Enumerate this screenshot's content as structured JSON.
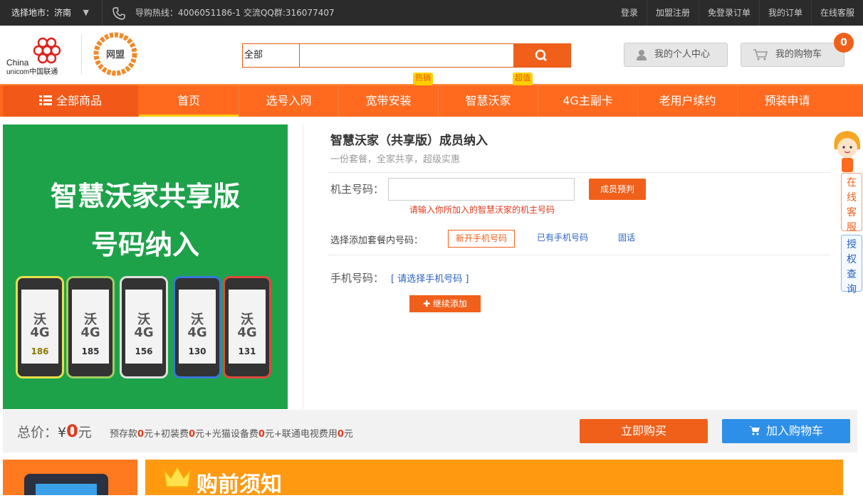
{
  "topbar": {
    "city_label": "选择地市：济南",
    "city_arrow": "▼",
    "hotline": "导购热线：4006051186-1   交流QQ群:316077407",
    "links": [
      "登录",
      "加盟注册",
      "免登录订单",
      "我的订单",
      "在线客服"
    ]
  },
  "header": {
    "logo_china": "China",
    "logo_unicom": "unicom中国联通",
    "logo_wm": "网盟",
    "search_category": "全部",
    "search_placeholder": "",
    "my_center": "我的个人中心",
    "my_cart": "我的购物车",
    "cart_count": "0"
  },
  "nav": {
    "all_goods": "全部商品",
    "items": [
      "首页",
      "选号入网",
      "宽带安装",
      "智慧沃家",
      "4G主副卡",
      "老用户续约",
      "预装申请"
    ],
    "tags": {
      "hot": "热销",
      "value": "超值"
    }
  },
  "banner": {
    "line1": "智慧沃家共享版",
    "line2": "号码纳入",
    "phones": [
      {
        "wo": "沃",
        "g": "4G",
        "num": "186",
        "frame": "#e8e04a",
        "numcolor": "#8a7a00"
      },
      {
        "wo": "沃",
        "g": "4G",
        "num": "185",
        "frame": "#a0d060",
        "numcolor": "#333"
      },
      {
        "wo": "沃",
        "g": "4G",
        "num": "156",
        "frame": "#e0e0e0",
        "numcolor": "#333"
      },
      {
        "wo": "沃",
        "g": "4G",
        "num": "130",
        "frame": "#3a78d8",
        "numcolor": "#333"
      },
      {
        "wo": "沃",
        "g": "4G",
        "num": "131",
        "frame": "#e04a3a",
        "numcolor": "#333"
      }
    ]
  },
  "product": {
    "title": "智慧沃家（共享版）成员纳入",
    "subtitle": "一份套餐，全家共享，超级实惠",
    "owner_label": "机主号码：",
    "owner_hint": "请输入你所加入的智慧沃家的机主号码",
    "check_button": "成员预判",
    "choose_label": "选择添加套餐内号码：",
    "options": [
      "新开手机号码",
      "已有手机号码",
      "固话"
    ],
    "mobile_label": "手机号码：",
    "pick_mobile": "[ 请选择手机号码 ]",
    "add_button": "✚ 继续添加"
  },
  "side": {
    "service": [
      "在",
      "线",
      "客",
      "服"
    ],
    "auth": [
      "授",
      "权",
      "查",
      "询"
    ]
  },
  "price": {
    "total_label": "总价：",
    "currency": "¥",
    "total": "0",
    "unit": "元",
    "detail_parts": [
      "预存款",
      "0",
      "元+初装费",
      "0",
      "元+光猫设备费",
      "0",
      "元+联通电视费用",
      "0",
      "元"
    ],
    "buy": "立即购买",
    "add_cart": "加入购物车"
  },
  "notice": {
    "title": "购前须知"
  },
  "colors": {
    "accent": "#f0601b",
    "nav": "#ff6a1f",
    "banner": "#1da24a",
    "blue": "#2e8fe8"
  }
}
